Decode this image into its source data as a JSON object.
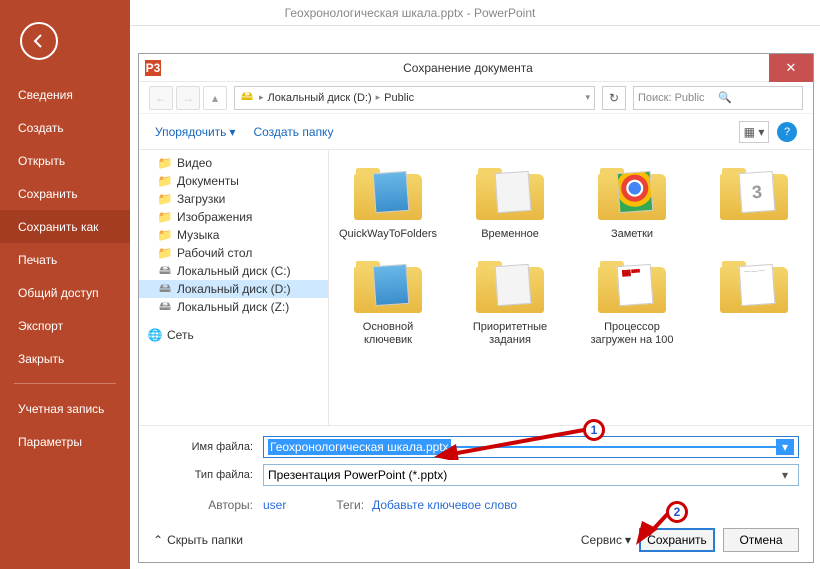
{
  "app_title": "Геохронологическая шкала.pptx - PowerPoint",
  "sidebar": {
    "items": [
      {
        "label": "Сведения"
      },
      {
        "label": "Создать"
      },
      {
        "label": "Открыть"
      },
      {
        "label": "Сохранить"
      },
      {
        "label": "Сохранить как"
      },
      {
        "label": "Печать"
      },
      {
        "label": "Общий доступ"
      },
      {
        "label": "Экспорт"
      },
      {
        "label": "Закрыть"
      }
    ],
    "account": "Учетная запись",
    "options": "Параметры"
  },
  "dialog": {
    "title": "Сохранение документа",
    "icon_text": "P3",
    "breadcrumb": {
      "disk": "Локальный диск (D:)",
      "folder": "Public"
    },
    "search_placeholder": "Поиск: Public",
    "toolbar": {
      "organize": "Упорядочить",
      "new_folder": "Создать папку"
    },
    "tree": [
      {
        "label": "Видео",
        "icon": "folder"
      },
      {
        "label": "Документы",
        "icon": "folder"
      },
      {
        "label": "Загрузки",
        "icon": "folder"
      },
      {
        "label": "Изображения",
        "icon": "folder"
      },
      {
        "label": "Музыка",
        "icon": "folder"
      },
      {
        "label": "Рабочий стол",
        "icon": "folder"
      },
      {
        "label": "Локальный диск (C:)",
        "icon": "disk"
      },
      {
        "label": "Локальный диск (D:)",
        "icon": "disk",
        "selected": true
      },
      {
        "label": "Локальный диск (Z:)",
        "icon": "disk"
      }
    ],
    "network": "Сеть",
    "folders_row1": [
      {
        "label": "QuickWayToFolders",
        "kind": "blue"
      },
      {
        "label": "Временное",
        "kind": "white"
      },
      {
        "label": "Заметки",
        "kind": "chrome"
      },
      {
        "label": "",
        "kind": "num"
      }
    ],
    "folders_row2": [
      {
        "label": "Основной ключевик",
        "kind": "blue"
      },
      {
        "label": "Приоритетные задания",
        "kind": "white"
      },
      {
        "label": "Процессор загружен на 100",
        "kind": "text"
      },
      {
        "label": "",
        "kind": "text2"
      }
    ],
    "filename_label": "Имя файла:",
    "filename_value": "Геохронологическая шкала.pptx",
    "filetype_label": "Тип файла:",
    "filetype_value": "Презентация PowerPoint (*.pptx)",
    "authors_label": "Авторы:",
    "authors_value": "user",
    "tags_label": "Теги:",
    "tags_value": "Добавьте ключевое слово",
    "hide_folders": "Скрыть папки",
    "service": "Сервис",
    "save": "Сохранить",
    "cancel": "Отмена"
  },
  "annotations": {
    "one": "1",
    "two": "2"
  }
}
